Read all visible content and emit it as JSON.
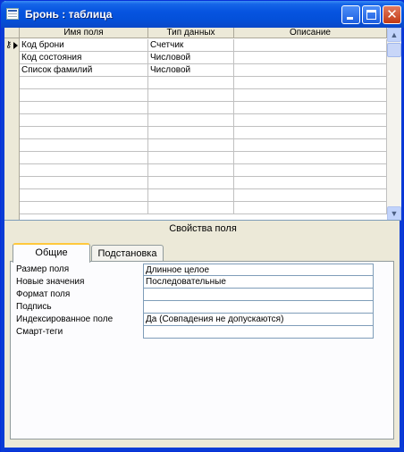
{
  "window": {
    "title": "Бронь : таблица"
  },
  "grid": {
    "columns": [
      "Имя поля",
      "Тип данных",
      "Описание"
    ],
    "rows": [
      {
        "field": "Код брони",
        "type": "Счетчик",
        "description": "",
        "primary_key": true,
        "current": true
      },
      {
        "field": "Код состояния",
        "type": "Числовой",
        "description": ""
      },
      {
        "field": "Список фамилий",
        "type": "Числовой",
        "description": ""
      }
    ],
    "empty_row_count": 11
  },
  "properties": {
    "section_label": "Свойства поля",
    "tabs": [
      {
        "label": "Общие",
        "active": true
      },
      {
        "label": "Подстановка",
        "active": false
      }
    ],
    "items": [
      {
        "label": "Размер поля",
        "value": "Длинное целое"
      },
      {
        "label": "Новые значения",
        "value": "Последовательные"
      },
      {
        "label": "Формат поля",
        "value": ""
      },
      {
        "label": "Подпись",
        "value": ""
      },
      {
        "label": "Индексированное поле",
        "value": "Да (Совпадения не допускаются)"
      },
      {
        "label": "Смарт-теги",
        "value": ""
      }
    ]
  },
  "icons": {
    "primary_key": "key-icon",
    "current_row": "current-row-arrow-icon"
  },
  "colors": {
    "titlebar": "#0654e0",
    "tab_highlight": "#ffc83c",
    "panel_background": "#ece9d8"
  }
}
